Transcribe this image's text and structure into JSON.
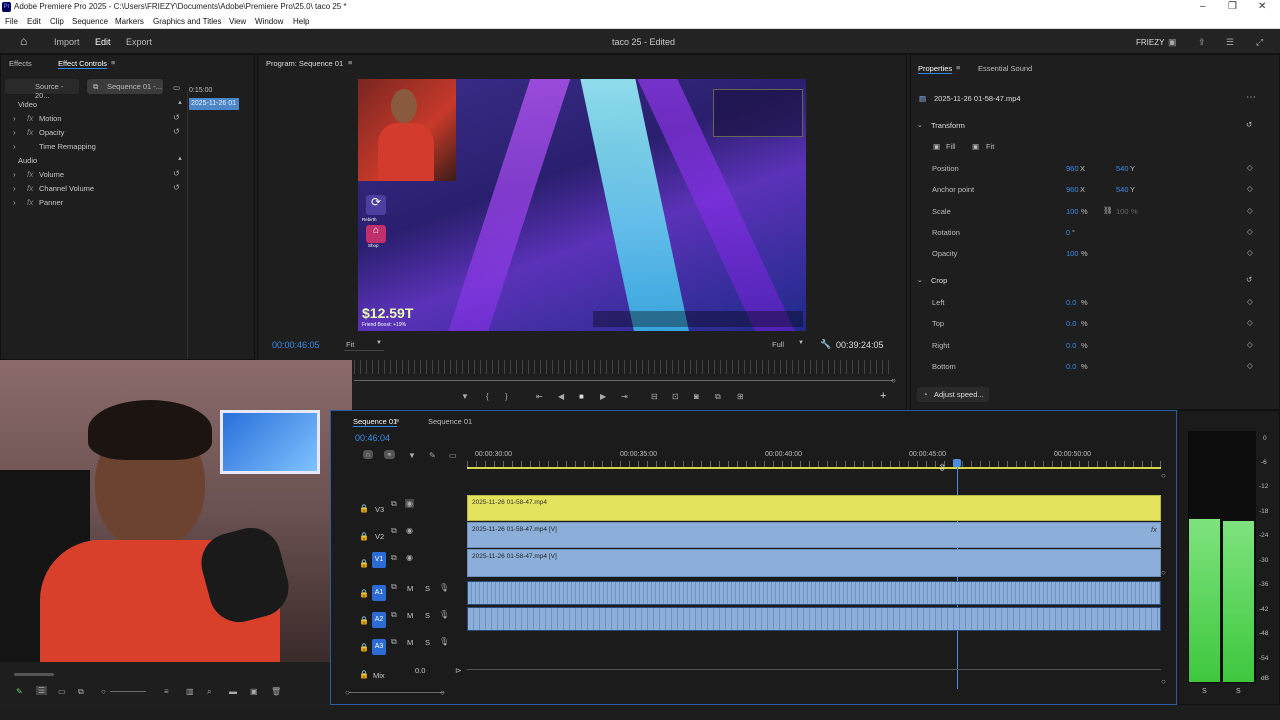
{
  "window": {
    "title": "Adobe Premiere Pro 2025 - C:\\Users\\FRIEZY\\Documents\\Adobe\\Premiere Pro\\25.0\\ taco 25 *",
    "app_icon": "Pr"
  },
  "menu": [
    "File",
    "Edit",
    "Clip",
    "Sequence",
    "Markers",
    "Graphics and Titles",
    "View",
    "Window",
    "Help"
  ],
  "workspace": {
    "home": "home-icon",
    "tabs": [
      "Import",
      "Edit",
      "Export"
    ],
    "active": "Edit",
    "project": "taco 25 - Edited",
    "user": "FRIEZY"
  },
  "effects_panel": {
    "tabs": [
      "Effects",
      "Effect Controls"
    ],
    "source_tab": "Source - 20...",
    "sequence_tab": "Sequence 01 -...",
    "timecode": "0:15:00",
    "clip_label": "2025-11-26 01",
    "sections": [
      {
        "name": "Video",
        "items": [
          "Motion",
          "Opacity",
          "Time Remapping"
        ]
      },
      {
        "name": "Audio",
        "items": [
          "Volume",
          "Channel Volume",
          "Panner"
        ]
      }
    ]
  },
  "program": {
    "title": "Program: Sequence 01",
    "timecode": "00:00:46:05",
    "fit": "Fit",
    "quality": "Full",
    "duration": "00:39:24:05",
    "game": {
      "money": "$12.59T",
      "boost": "Friend Boost: +19%",
      "side_buttons": [
        "Rebirth",
        "Shop"
      ]
    }
  },
  "properties": {
    "tabs": [
      "Properties",
      "Essential Sound"
    ],
    "clip": "2025-11-26 01-58-47.mp4",
    "transform": {
      "title": "Transform",
      "fill": "Fill",
      "fit": "Fit",
      "rows": [
        {
          "label": "Position",
          "v1": "960",
          "u1": "X",
          "v2": "540",
          "u2": "Y"
        },
        {
          "label": "Anchor point",
          "v1": "960",
          "u1": "X",
          "v2": "540",
          "u2": "Y"
        },
        {
          "label": "Scale",
          "v1": "100",
          "u1": "%",
          "v2": "100",
          "u2": "%"
        },
        {
          "label": "Rotation",
          "v1": "0",
          "u1": "°",
          "v2": "",
          "u2": ""
        },
        {
          "label": "Opacity",
          "v1": "100",
          "u1": "%",
          "v2": "",
          "u2": ""
        }
      ]
    },
    "crop": {
      "title": "Crop",
      "rows": [
        {
          "label": "Left",
          "v": "0.0",
          "u": "%"
        },
        {
          "label": "Top",
          "v": "0.0",
          "u": "%"
        },
        {
          "label": "Right",
          "v": "0.0",
          "u": "%"
        },
        {
          "label": "Bottom",
          "v": "0.0",
          "u": "%"
        }
      ]
    },
    "adjust_speed": "Adjust speed..."
  },
  "timeline": {
    "tabs": [
      "Sequence 01",
      "Sequence 01"
    ],
    "timecode": "00:46:04",
    "ruler": [
      "00:00:30:00",
      "00:00:35:00",
      "00:00:40:00",
      "00:00:45:00",
      "00:00:50:00"
    ],
    "video_tracks": [
      {
        "name": "V3",
        "clip": "2025-11-26 01-58-47.mp4"
      },
      {
        "name": "V2",
        "clip": "2025-11-26 01-58-47.mp4 [V]"
      },
      {
        "name": "V1",
        "clip": "2025-11-26 01-58-47.mp4 [V]"
      }
    ],
    "audio_tracks": [
      {
        "name": "A1",
        "m": "M",
        "s": "S"
      },
      {
        "name": "A2",
        "m": "M",
        "s": "S"
      },
      {
        "name": "A3",
        "m": "M",
        "s": "S"
      }
    ],
    "mix": {
      "label": "Mix",
      "value": "0.0"
    }
  },
  "meter": {
    "labels": [
      "0",
      "-6",
      "-12",
      "-18",
      "-24",
      "-30",
      "-36",
      "-42",
      "-48",
      "-54",
      "dB"
    ],
    "solo": [
      "S",
      "S"
    ]
  }
}
